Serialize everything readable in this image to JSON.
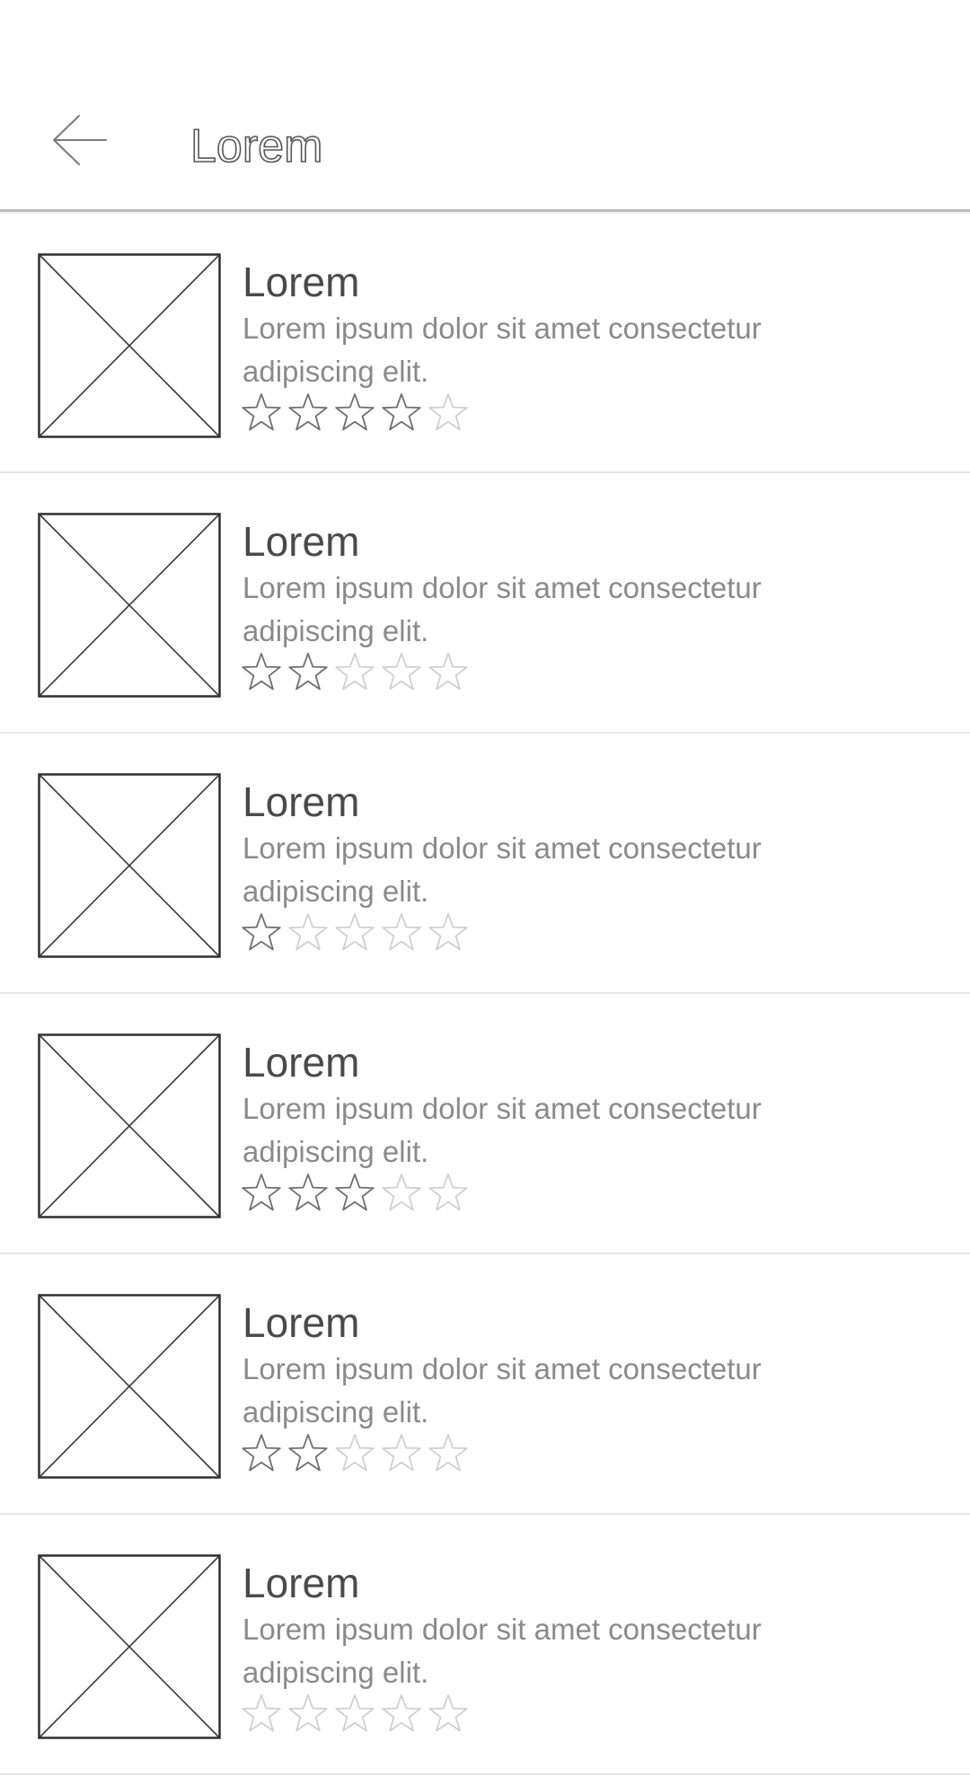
{
  "app_bar": {
    "title": "Lorem",
    "back_icon": "arrow-left-icon"
  },
  "items": [
    {
      "title": "Lorem",
      "description": "Lorem ipsum dolor sit amet consectetur adipiscing elit.",
      "rating": 4,
      "max_rating": 5
    },
    {
      "title": "Lorem",
      "description": "Lorem ipsum dolor sit amet consectetur adipiscing elit.",
      "rating": 2,
      "max_rating": 5
    },
    {
      "title": "Lorem",
      "description": "Lorem ipsum dolor sit amet consectetur adipiscing elit.",
      "rating": 1,
      "max_rating": 5
    },
    {
      "title": "Lorem",
      "description": "Lorem ipsum dolor sit amet consectetur adipiscing elit.",
      "rating": 3,
      "max_rating": 5
    },
    {
      "title": "Lorem",
      "description": "Lorem ipsum dolor sit amet consectetur adipiscing elit.",
      "rating": 2,
      "max_rating": 5
    },
    {
      "title": "Lorem",
      "description": "Lorem ipsum dolor sit amet consectetur adipiscing elit.",
      "rating": 0,
      "max_rating": 5
    }
  ],
  "colors": {
    "star_filled_stroke": "#6e6e6e",
    "star_empty_stroke": "#cfcfcf",
    "divider": "#e6e6e6",
    "title_text": "#4a4a4a",
    "description_text": "#8a8a8a"
  }
}
